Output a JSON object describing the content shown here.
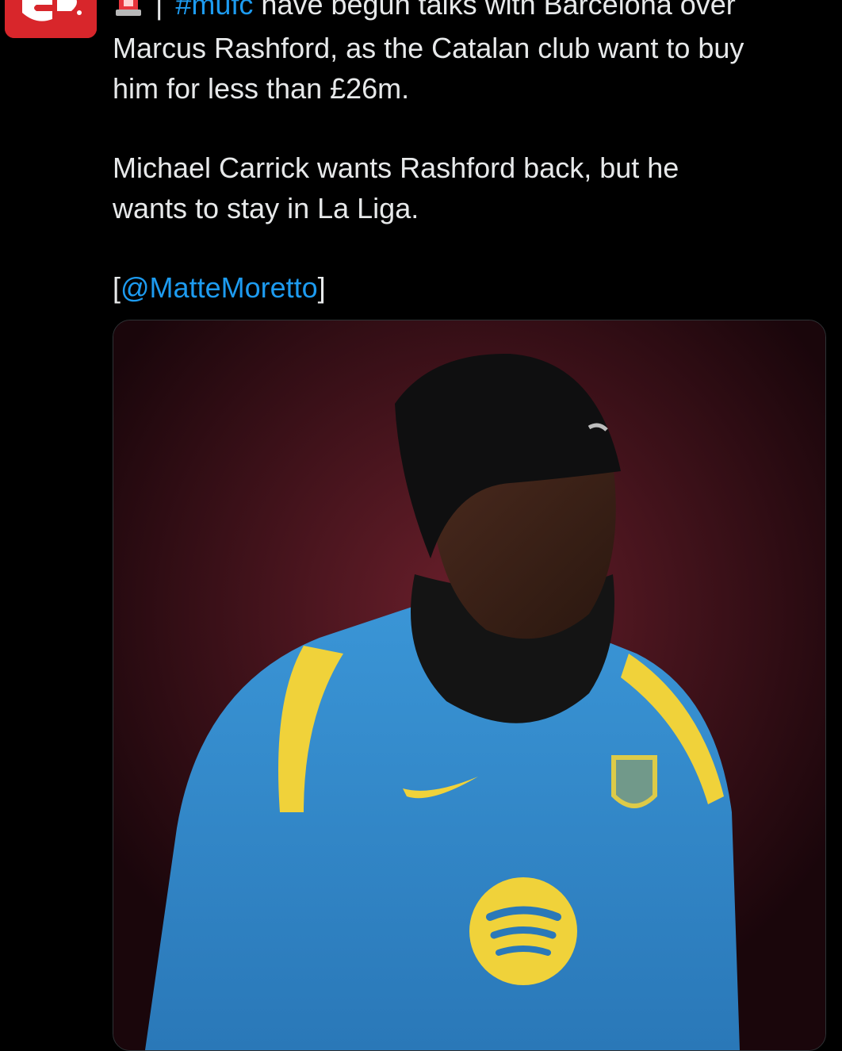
{
  "avatar": {
    "icon": "news-outlet-logo",
    "color": "#d8262b"
  },
  "tweet": {
    "line1_emoji": "rotating-light",
    "line1_separator": "|",
    "line1_hashtag": "#mufc",
    "line1_text": " have begun talks with Barcelona over",
    "line2": "Marcus Rashford, as the Catalan club want to buy",
    "line3": "him for less than £26m.",
    "line4": "Michael Carrick wants Rashford back, but he",
    "line5": "wants to stay in La Liga.",
    "mention_open": "[",
    "mention": "@MatteMoretto",
    "mention_close": "]"
  },
  "media": {
    "description_icon": "player-photo",
    "background_color": "#3e0f17",
    "jersey_color": "#2f86c8",
    "accent_color": "#f0d23a"
  },
  "colors": {
    "background": "#000000",
    "text": "#e7e9ea",
    "link": "#1d9bf0"
  }
}
